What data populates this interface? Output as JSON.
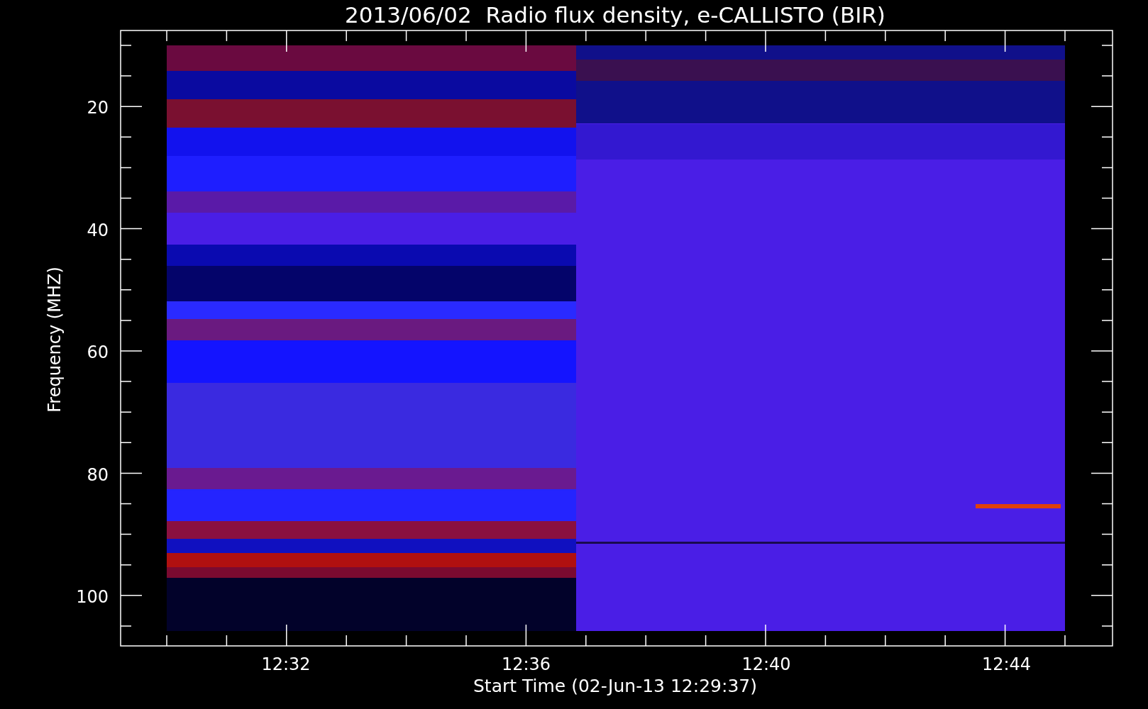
{
  "title": "2013/06/02  Radio flux density, e-CALLISTO (BIR)",
  "y_axis": {
    "title": "Frequency (MHZ)",
    "ticks": [
      "20",
      "40",
      "60",
      "80",
      "100"
    ]
  },
  "x_axis": {
    "title": "Start Time (02-Jun-13 12:29:37)",
    "ticks": [
      "12:32",
      "12:36",
      "12:40",
      "12:44"
    ]
  }
}
